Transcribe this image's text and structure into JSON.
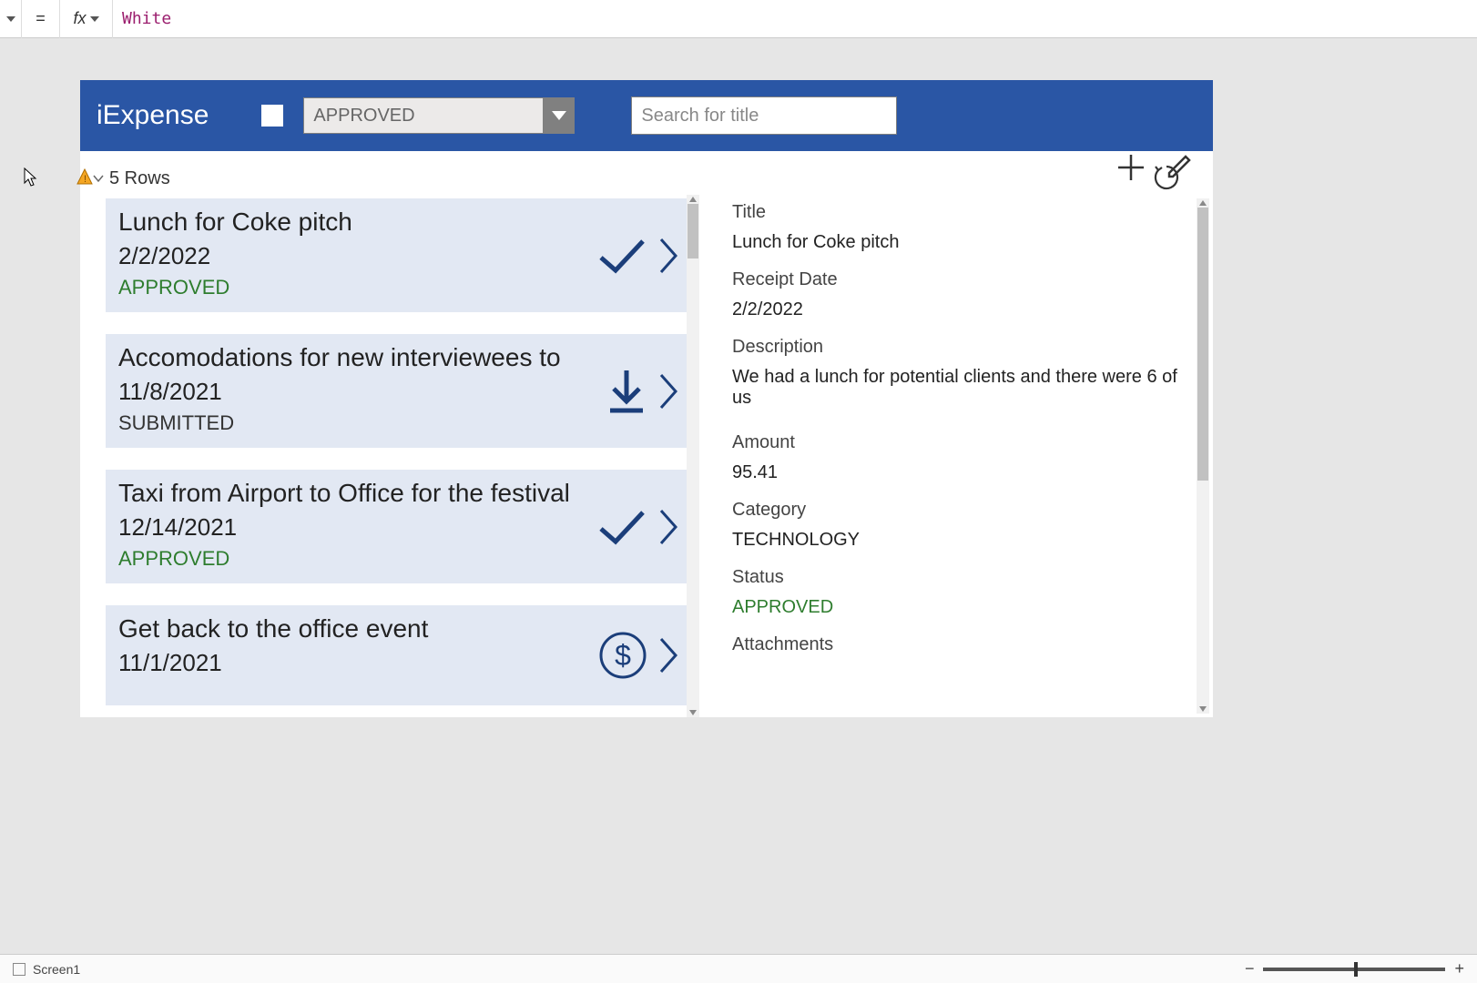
{
  "formula_bar": {
    "fx": "fx",
    "eq": "=",
    "value": "White"
  },
  "header": {
    "app_title": "iExpense",
    "filter_value": "APPROVED",
    "search_placeholder": "Search for title"
  },
  "list": {
    "row_count_label": "5 Rows",
    "items": [
      {
        "title": "Lunch for Coke pitch",
        "date": "2/2/2022",
        "status": "APPROVED",
        "status_class": "st-approved",
        "icon": "check"
      },
      {
        "title": "Accomodations for new interviewees to",
        "date": "11/8/2021",
        "status": "SUBMITTED",
        "status_class": "st-submitted",
        "icon": "download"
      },
      {
        "title": "Taxi from Airport to Office for the festival",
        "date": "12/14/2021",
        "status": "APPROVED",
        "status_class": "st-approved",
        "icon": "check"
      },
      {
        "title": "Get back to the office event",
        "date": "11/1/2021",
        "status": "",
        "status_class": "",
        "icon": "dollar"
      }
    ]
  },
  "detail": {
    "labels": {
      "title": "Title",
      "receipt_date": "Receipt Date",
      "description": "Description",
      "amount": "Amount",
      "category": "Category",
      "status": "Status",
      "attachments": "Attachments"
    },
    "values": {
      "title": "Lunch for Coke pitch",
      "receipt_date": "2/2/2022",
      "description": "We had a lunch for potential clients and there were 6 of us",
      "amount": "95.41",
      "category": "TECHNOLOGY",
      "status": "APPROVED"
    }
  },
  "status_bar": {
    "screen_name": "Screen1"
  }
}
